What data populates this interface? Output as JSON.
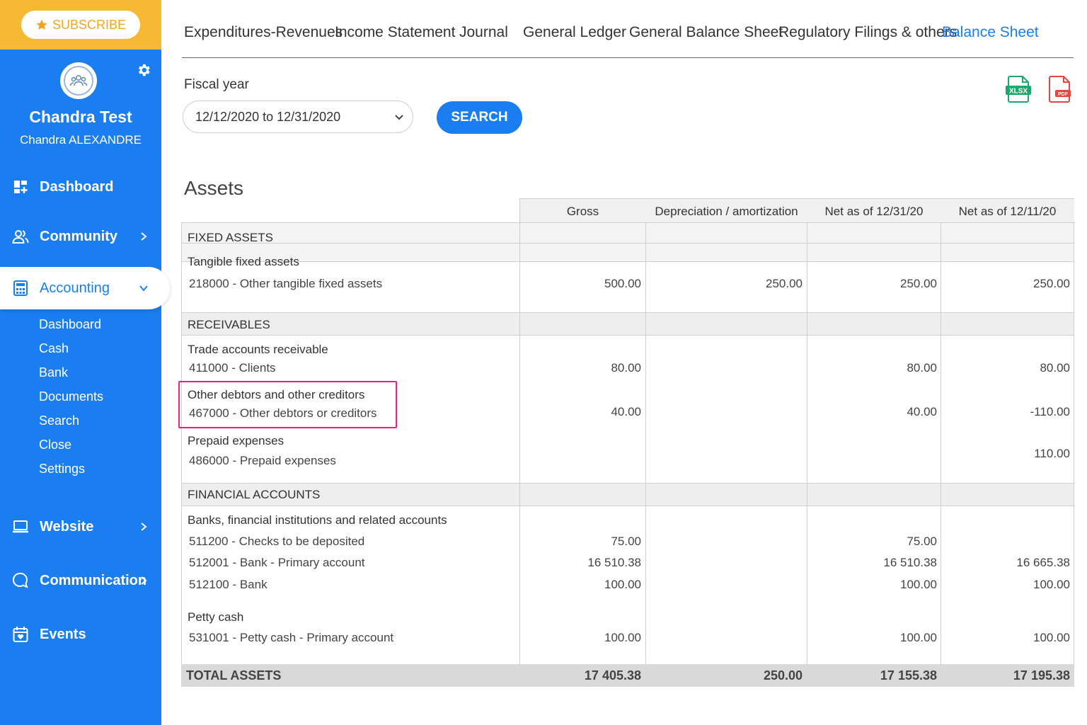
{
  "sidebar": {
    "subscribe_label": "SUBSCRIBE",
    "profile_name": "Chandra Test",
    "profile_sub": "Chandra ALEXANDRE",
    "nav": {
      "dashboard": "Dashboard",
      "community": "Community",
      "accounting": "Accounting",
      "website": "Website",
      "communication": "Communication",
      "events": "Events"
    },
    "accounting_sub": [
      "Dashboard",
      "Cash",
      "Bank",
      "Documents",
      "Search",
      "Close",
      "Settings"
    ]
  },
  "tabs": [
    "Expenditures-Revenues",
    "Income Statement",
    "Journal",
    "General Ledger",
    "General Balance Sheet",
    "Regulatory Filings & others",
    "Balance Sheet"
  ],
  "active_tab": "Balance Sheet",
  "filter": {
    "label": "Fiscal year",
    "value": "12/12/2020 to 12/31/2020",
    "search_label": "SEARCH"
  },
  "exports": {
    "xlsx": "XLSX",
    "pdf": "PDF"
  },
  "colors": {
    "primary": "#1b7ef0",
    "subscribe": "#f7b833",
    "xlsx": "#1ba86a",
    "pdf": "#e8453c",
    "highlight": "#e8218a"
  },
  "assets": {
    "title": "Assets",
    "columns": [
      "Gross",
      "Depreciation / amortization",
      "Net as of 12/31/20",
      "Net as of 12/11/20"
    ],
    "fixed": {
      "section": "FIXED ASSETS",
      "group": "Tangible fixed assets",
      "row": {
        "label": "218000 - Other tangible fixed assets",
        "gross": "500.00",
        "dep": "250.00",
        "net1": "250.00",
        "net2": "250.00"
      }
    },
    "receivables": {
      "section": "RECEIVABLES",
      "trade_group": "Trade accounts receivable",
      "clients": {
        "label": "411000 - Clients",
        "gross": "80.00",
        "net1": "80.00",
        "net2": "80.00"
      },
      "other_group": "Other debtors and other creditors",
      "other": {
        "label": "467000 - Other debtors or creditors",
        "gross": "40.00",
        "net1": "40.00",
        "net2": "-110.00"
      },
      "prepaid_group": "Prepaid expenses",
      "prepaid": {
        "label": "486000 - Prepaid expenses",
        "net2": "110.00"
      }
    },
    "financial": {
      "section": "FINANCIAL ACCOUNTS",
      "banks_group": "Banks, financial institutions and related accounts",
      "checks": {
        "label": "511200 - Checks to be deposited",
        "gross": "75.00",
        "net1": "75.00"
      },
      "bank_primary": {
        "label": "512001 - Bank - Primary account",
        "gross": "16 510.38",
        "net1": "16 510.38",
        "net2": "16 665.38"
      },
      "bank": {
        "label": "512100 - Bank",
        "gross": "100.00",
        "net1": "100.00",
        "net2": "100.00"
      },
      "petty_group": "Petty cash",
      "petty": {
        "label": "531001 - Petty cash - Primary account",
        "gross": "100.00",
        "net1": "100.00",
        "net2": "100.00"
      }
    },
    "total": {
      "label": "TOTAL ASSETS",
      "gross": "17 405.38",
      "dep": "250.00",
      "net1": "17 155.38",
      "net2": "17 195.38"
    }
  }
}
